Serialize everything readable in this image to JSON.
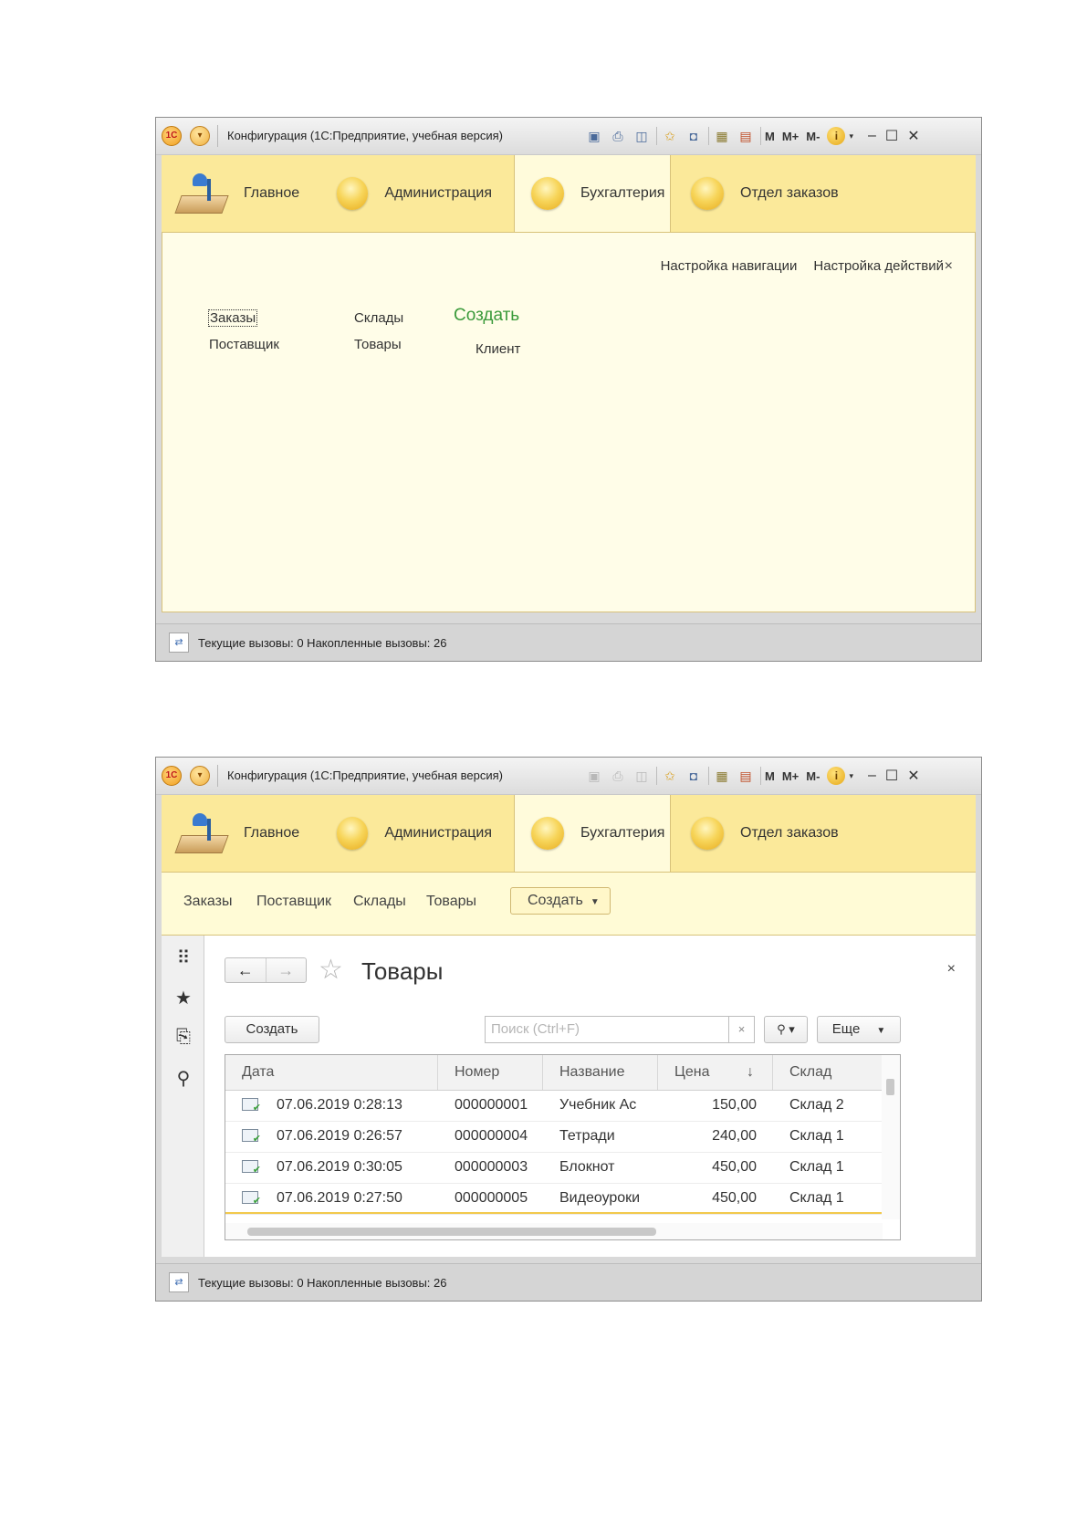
{
  "window_title": "Конфигурация  (1С:Предприятие, учебная версия)",
  "toolbar": {
    "m": "M",
    "mplus": "M+",
    "mminus": "M-"
  },
  "sections": [
    {
      "label": "Главное"
    },
    {
      "label": "Администрация"
    },
    {
      "label": "Бухгалтерия",
      "active": true
    },
    {
      "label": "Отдел заказов"
    }
  ],
  "screen1": {
    "nav_settings": "Настройка навигации",
    "action_settings": "Настройка действий",
    "close": "×",
    "commands": {
      "orders": "Заказы",
      "supplier": "Поставщик",
      "warehouses": "Склады",
      "goods": "Товары",
      "create_header": "Создать",
      "client": "Клиент"
    }
  },
  "screen2": {
    "cmdbar": [
      "Заказы",
      "Поставщик",
      "Склады",
      "Товары"
    ],
    "create_menu": "Создать",
    "form": {
      "title": "Товары",
      "close": "×",
      "create_button": "Создать",
      "search_placeholder": "Поиск (Ctrl+F)",
      "search_clear": "×",
      "more_button": "Еще",
      "columns": [
        "Дата",
        "Номер",
        "Название",
        "Цена",
        "Склад"
      ],
      "sort_indicator": "↓",
      "rows": [
        {
          "date": "07.06.2019 0:28:13",
          "number": "000000001",
          "name": "Учебник Ас",
          "price": "150,00",
          "warehouse": "Склад 2"
        },
        {
          "date": "07.06.2019 0:26:57",
          "number": "000000004",
          "name": "Тетради",
          "price": "240,00",
          "warehouse": "Склад 1"
        },
        {
          "date": "07.06.2019 0:30:05",
          "number": "000000003",
          "name": "Блокнот",
          "price": "450,00",
          "warehouse": "Склад 1"
        },
        {
          "date": "07.06.2019 0:27:50",
          "number": "000000005",
          "name": "Видеоуроки",
          "price": "450,00",
          "warehouse": "Склад 1"
        }
      ]
    }
  },
  "status": "Текущие вызовы: 0   Накопленные вызовы: 26",
  "icons": {
    "logo": "1c-logo-icon",
    "menu": "main-menu-icon",
    "save": "save-icon",
    "print": "print-icon",
    "preview": "preview-icon",
    "favorites": "favorites-icon",
    "bookmark": "bookmark-icon",
    "calculator": "calculator-icon",
    "calendar": "calendar-icon",
    "info": "info-icon"
  }
}
